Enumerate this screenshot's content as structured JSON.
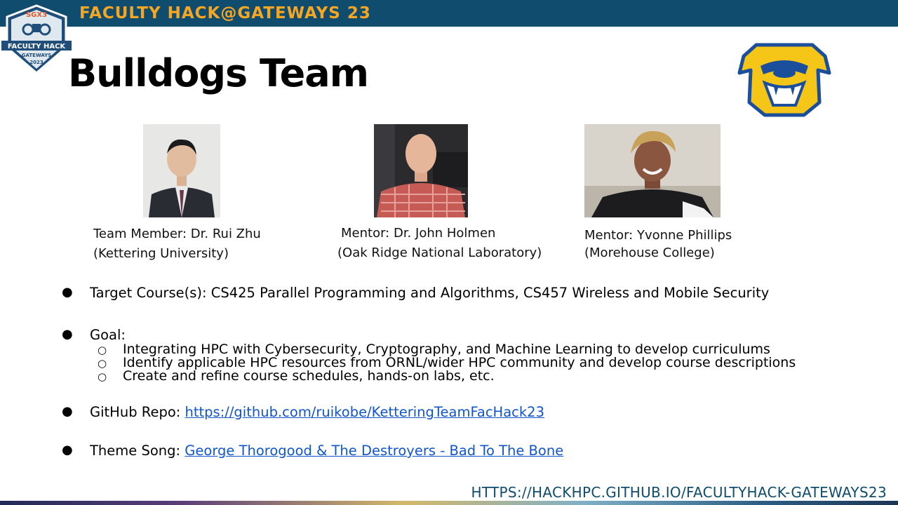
{
  "header": {
    "banner_title": "FACULTY HACK@GATEWAYS 23",
    "badge_text": {
      "org": "SGX3",
      "line1": "FACULTY HACK",
      "line2": "GATEWAYS",
      "year": "2023"
    },
    "banner_color": "#0f4c6e",
    "accent_color": "#f5a623"
  },
  "slide": {
    "title": "Bulldogs Team"
  },
  "people": [
    {
      "role_line": "Team Member: Dr. Rui Zhu",
      "affiliation": "(Kettering University)"
    },
    {
      "role_line": "Mentor: Dr. John Holmen",
      "affiliation": "(Oak Ridge National Laboratory)"
    },
    {
      "role_line": "Mentor: Yvonne Phillips",
      "affiliation": "(Morehouse College)"
    }
  ],
  "bullets": {
    "course": "Target Course(s): CS425 Parallel Programming and Algorithms, CS457 Wireless and Mobile Security",
    "goal_label": "Goal:",
    "goals": [
      "Integrating HPC with Cybersecurity, Cryptography, and Machine Learning to develop curriculums",
      "Identify applicable HPC resources from ORNL/wider HPC community and develop course descriptions",
      "Create and refine course schedules, hands-on labs, etc."
    ],
    "repo_label": "GitHub Repo: ",
    "repo_link": "https://github.com/ruikobe/KetteringTeamFacHack23",
    "song_label": "Theme Song: ",
    "song_link": "George Thorogood & The Destroyers - Bad To The Bone"
  },
  "footer": {
    "url": "HTTPS://HACKHPC.GITHUB.IO/FACULTYHACK-GATEWAYS23"
  },
  "icons": {
    "badge": "faculty-hack-badge-icon",
    "mascot": "bulldog-mascot-icon",
    "bullet": "bullet-dot-icon",
    "sub_bullet": "hollow-circle-icon"
  }
}
